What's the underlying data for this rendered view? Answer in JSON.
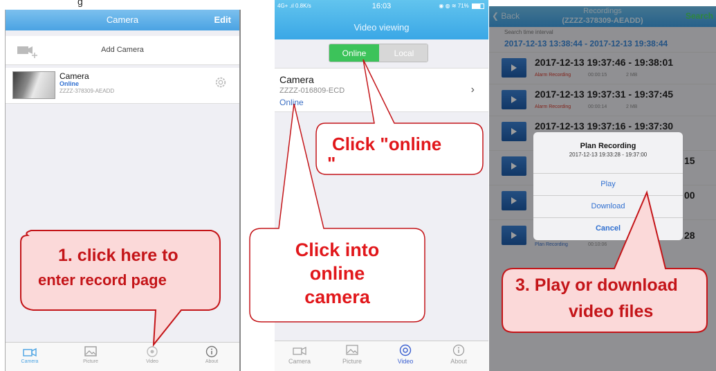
{
  "top_fragment": "g",
  "panel1": {
    "nav_title": "Camera",
    "edit_label": "Edit",
    "add_camera_label": "Add Camera",
    "camera": {
      "name": "Camera",
      "status": "Online",
      "id": "ZZZZ-378309-AEADD"
    },
    "tabs": [
      {
        "label": "Camera",
        "icon": "camera-icon"
      },
      {
        "label": "Picture",
        "icon": "picture-icon"
      },
      {
        "label": "Video",
        "icon": "video-icon"
      },
      {
        "label": "About",
        "icon": "info-icon"
      }
    ],
    "callout": [
      "1. click here to",
      "enter record page"
    ]
  },
  "panel2": {
    "status_left": "4G+ ‌.ıl 0.8K/s",
    "status_time": "16:03",
    "status_right": "71%",
    "title": "Video viewing",
    "seg_online": "Online",
    "seg_local": "Local",
    "camera": {
      "name": "Camera",
      "id": "ZZZZ-016809-ECD",
      "status": "Online"
    },
    "tabs": [
      {
        "label": "Camera",
        "icon": "camera-icon"
      },
      {
        "label": "Picture",
        "icon": "picture-icon"
      },
      {
        "label": "Video",
        "icon": "video-icon"
      },
      {
        "label": "About",
        "icon": "info-icon"
      }
    ],
    "callout_online": [
      "Click \"online",
      "\""
    ],
    "callout_into": [
      "Click into",
      "online",
      "camera"
    ]
  },
  "panel3": {
    "back_label": "Back",
    "title_line1": "Recordings",
    "title_line2": "(ZZZZ-378309-AEADD)",
    "search_label": "Search",
    "search_interval_label": "Search time interval",
    "range": "2017-12-13 13:38:44 - 2017-12-13 19:38:44",
    "records": [
      {
        "time": "2017-12-13  19:37:46 - 19:38:01",
        "type": "Alarm Recording",
        "duration": "00:00:15",
        "size": "2 MB"
      },
      {
        "time": "2017-12-13  19:37:31 - 19:37:45",
        "type": "Alarm Recording",
        "duration": "00:00:14",
        "size": "2 MB"
      },
      {
        "time": "2017-12-13  19:37:16 - 19:37:30",
        "type": "",
        "duration": "",
        "size": ""
      },
      {
        "time": "15",
        "type": "",
        "duration": "",
        "size": ""
      },
      {
        "time": "00",
        "type": "",
        "duration": "",
        "size": ""
      },
      {
        "time": "28",
        "type": "Plan Recording",
        "duration": "00:10:06",
        "size": ""
      }
    ],
    "dialog": {
      "title": "Plan Recording",
      "subtitle": "2017-12-13  19:33:28 - 19:37:00",
      "play": "Play",
      "download": "Download",
      "cancel": "Cancel"
    },
    "callout": [
      "3. Play or download",
      "video files"
    ]
  }
}
